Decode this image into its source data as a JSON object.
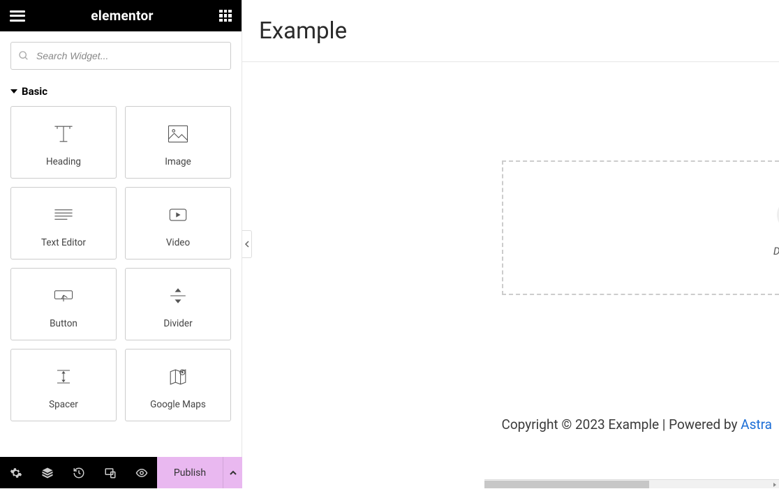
{
  "topbar": {
    "brand": "elementor"
  },
  "search": {
    "placeholder": "Search Widget..."
  },
  "category": {
    "label": "Basic"
  },
  "widgets": [
    {
      "name": "heading",
      "label": "Heading"
    },
    {
      "name": "image",
      "label": "Image"
    },
    {
      "name": "text-editor",
      "label": "Text Editor"
    },
    {
      "name": "video",
      "label": "Video"
    },
    {
      "name": "button",
      "label": "Button"
    },
    {
      "name": "divider",
      "label": "Divider"
    },
    {
      "name": "spacer",
      "label": "Spacer"
    },
    {
      "name": "google-maps",
      "label": "Google Maps"
    }
  ],
  "bottombar": {
    "publish": "Publish"
  },
  "page": {
    "title": "Example"
  },
  "dropzone": {
    "hint": "Drag widget here"
  },
  "footer": {
    "text": "Copyright © 2023 Example | Powered by ",
    "link_text": "Astra"
  }
}
